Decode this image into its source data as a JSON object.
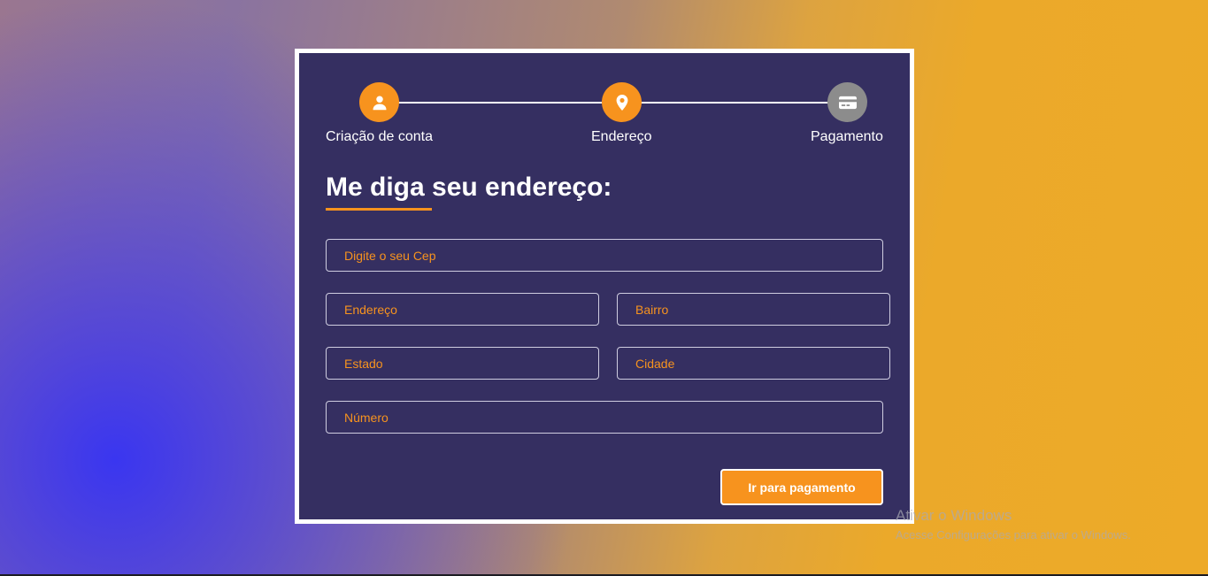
{
  "steps": [
    {
      "label": "Criação de conta",
      "icon": "user-icon",
      "state": "active"
    },
    {
      "label": "Endereço",
      "icon": "map-pin-icon",
      "state": "active"
    },
    {
      "label": "Pagamento",
      "icon": "credit-card-icon",
      "state": "inactive"
    }
  ],
  "form": {
    "title": "Me diga seu endereço:",
    "cep_placeholder": "Digite o seu Cep",
    "endereco_placeholder": "Endereço",
    "bairro_placeholder": "Bairro",
    "estado_placeholder": "Estado",
    "cidade_placeholder": "Cidade",
    "numero_placeholder": "Número",
    "submit_label": "Ir para pagamento"
  },
  "watermark": {
    "title": "Ativar o Windows",
    "subtitle": "Acesse Configurações para ativar o Windows."
  },
  "colors": {
    "accent": "#f7931e",
    "panel": "#352f61",
    "inactive_step": "#8c8c8c"
  }
}
